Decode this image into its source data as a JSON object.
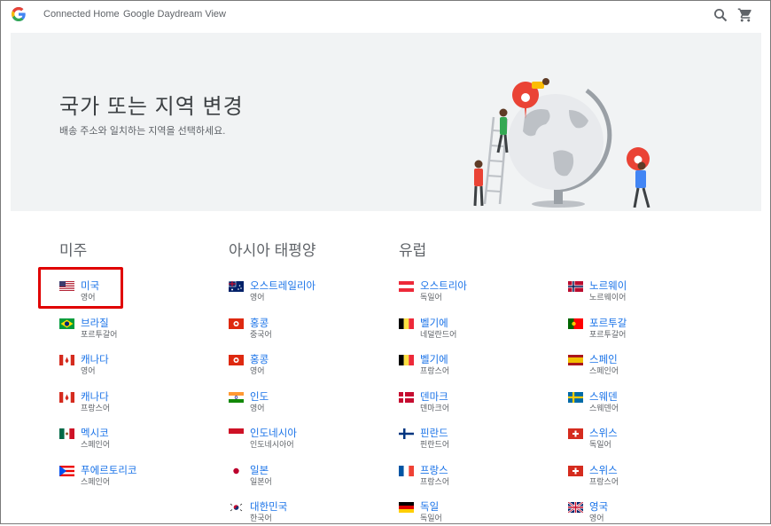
{
  "header": {
    "logo_letter": "G",
    "nav_links": [
      "Connected Home",
      "Google Daydream View"
    ],
    "icons": [
      "search-icon",
      "cart-icon"
    ]
  },
  "hero": {
    "title": "국가 또는 지역 변경",
    "subtitle": "배송 주소와 일치하는 지역을 선택하세요."
  },
  "regions": [
    {
      "heading": "미주",
      "columns": [
        [
          {
            "name": "미국",
            "lang": "영어",
            "flag": "us"
          },
          {
            "name": "브라질",
            "lang": "포르투갈어",
            "flag": "br"
          },
          {
            "name": "캐나다",
            "lang": "영어",
            "flag": "ca"
          },
          {
            "name": "캐나다",
            "lang": "프랑스어",
            "flag": "ca"
          },
          {
            "name": "멕시코",
            "lang": "스페인어",
            "flag": "mx"
          },
          {
            "name": "푸에르토리코",
            "lang": "스페인어",
            "flag": "pr"
          }
        ]
      ]
    },
    {
      "heading": "아시아 태평양",
      "columns": [
        [
          {
            "name": "오스트레일리아",
            "lang": "영어",
            "flag": "au"
          },
          {
            "name": "홍콩",
            "lang": "중국어",
            "flag": "hk"
          },
          {
            "name": "홍콩",
            "lang": "영어",
            "flag": "hk"
          },
          {
            "name": "인도",
            "lang": "영어",
            "flag": "in"
          },
          {
            "name": "인도네시아",
            "lang": "인도네시아어",
            "flag": "id"
          },
          {
            "name": "일본",
            "lang": "일본어",
            "flag": "jp"
          },
          {
            "name": "대한민국",
            "lang": "한국어",
            "flag": "kr"
          }
        ]
      ]
    },
    {
      "heading": "유럽",
      "columns": [
        [
          {
            "name": "오스트리아",
            "lang": "독일어",
            "flag": "at"
          },
          {
            "name": "벨기에",
            "lang": "네덜란드어",
            "flag": "be"
          },
          {
            "name": "벨기에",
            "lang": "프랑스어",
            "flag": "be"
          },
          {
            "name": "덴마크",
            "lang": "덴마크어",
            "flag": "dk"
          },
          {
            "name": "핀란드",
            "lang": "핀란드어",
            "flag": "fi"
          },
          {
            "name": "프랑스",
            "lang": "프랑스어",
            "flag": "fr"
          },
          {
            "name": "독일",
            "lang": "독일어",
            "flag": "de"
          }
        ],
        [
          {
            "name": "노르웨이",
            "lang": "노르웨이어",
            "flag": "no"
          },
          {
            "name": "포르투갈",
            "lang": "포르투갈어",
            "flag": "pt"
          },
          {
            "name": "스페인",
            "lang": "스페인어",
            "flag": "es"
          },
          {
            "name": "스웨덴",
            "lang": "스웨덴어",
            "flag": "se"
          },
          {
            "name": "스위스",
            "lang": "독일어",
            "flag": "ch"
          },
          {
            "name": "스위스",
            "lang": "프랑스어",
            "flag": "ch"
          },
          {
            "name": "영국",
            "lang": "영어",
            "flag": "gb"
          }
        ]
      ]
    }
  ],
  "selected_country": "미국"
}
